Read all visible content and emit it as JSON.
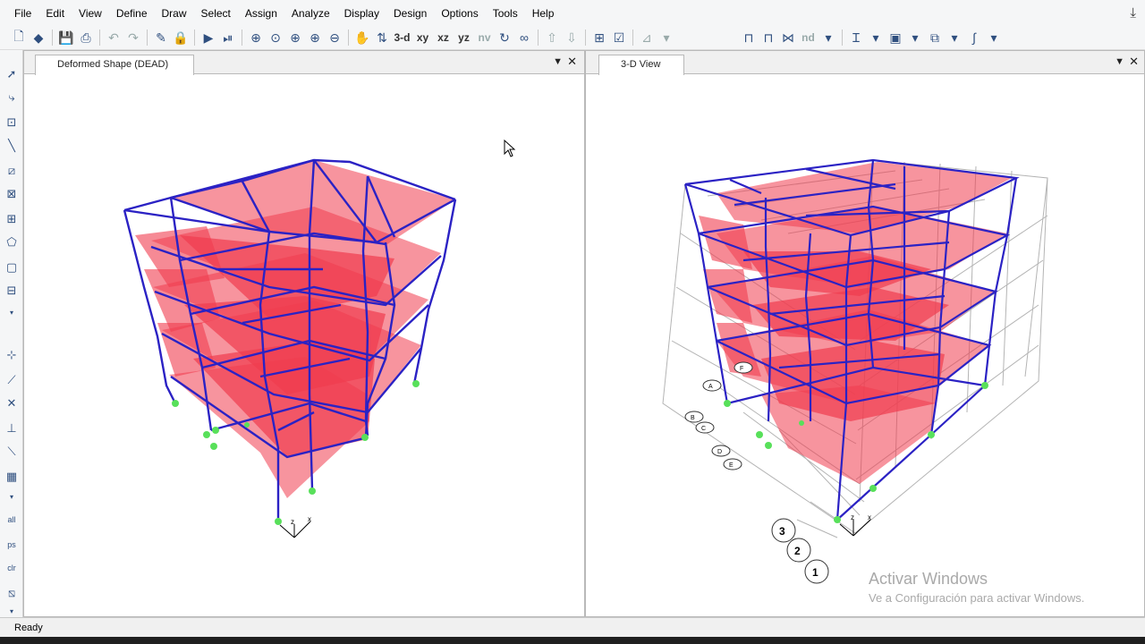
{
  "menu": [
    "File",
    "Edit",
    "View",
    "Define",
    "Draw",
    "Select",
    "Assign",
    "Analyze",
    "Display",
    "Design",
    "Options",
    "Tools",
    "Help"
  ],
  "toolbar": {
    "view_3d": "3-d",
    "view_xy": "xy",
    "view_xz": "xz",
    "view_yz": "yz",
    "view_nv": "nv",
    "view_nd": "nd"
  },
  "left_pane": {
    "tab_title": "Deformed Shape (DEAD)",
    "axis_labels": [
      "z",
      "x"
    ]
  },
  "right_pane": {
    "tab_title": "3-D View",
    "axis_labels": [
      "z",
      "x"
    ],
    "grid_bubbles_front": [
      "3",
      "2",
      "1"
    ],
    "grid_bubbles_side": [
      "A",
      "B",
      "C",
      "D",
      "E",
      "F"
    ]
  },
  "left_tools_text": [
    "all",
    "ps",
    "clr"
  ],
  "status": "Ready",
  "watermark": {
    "line1": "Activar Windows",
    "line2": "Ve a Configuración para activar Windows."
  },
  "colors": {
    "frame": "#2b22c4",
    "slab": "#f03c4e",
    "support": "#58e05a",
    "grid": "#b4b4b4"
  }
}
